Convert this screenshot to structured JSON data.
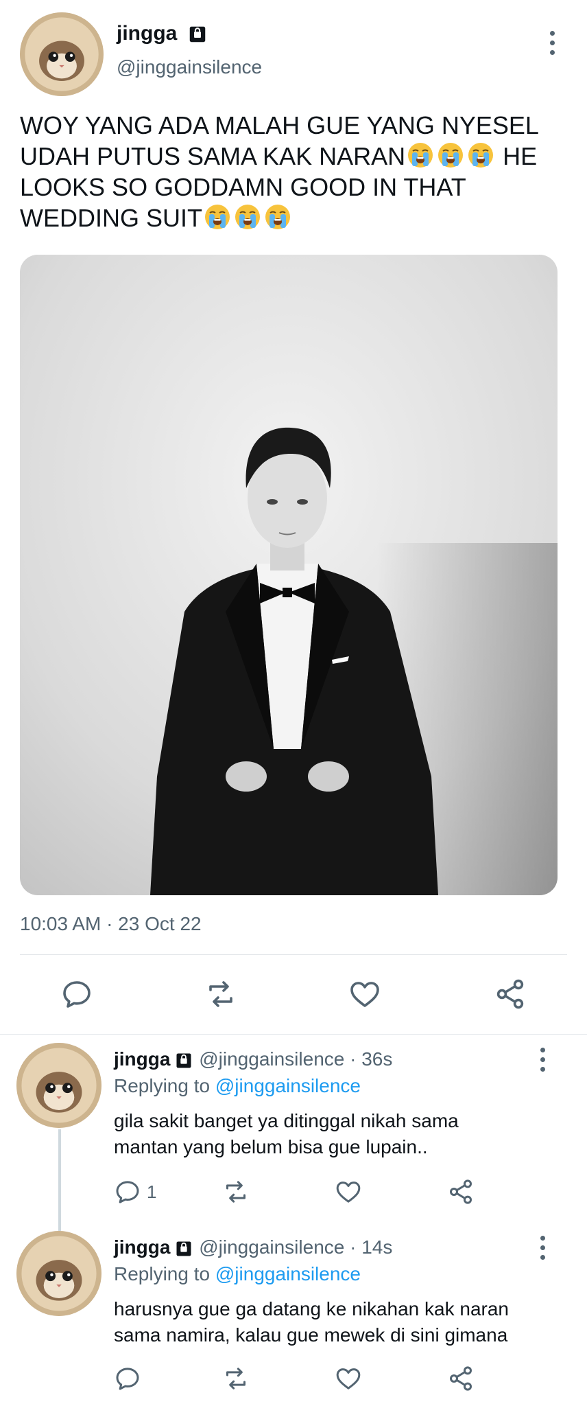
{
  "main_tweet": {
    "display_name": "jingga",
    "handle": "@jinggainsilence",
    "text_line1": "WOY YANG ADA MALAH GUE YANG NYESEL",
    "text_line2a": "UDAH PUTUS SAMA KAK NARAN",
    "text_line2b": "HE",
    "text_line3": "LOOKS SO GODDAMN GOOD IN THAT",
    "text_line4": "WEDDING SUIT",
    "timestamp": "10:03 AM · 23 Oct 22"
  },
  "replies": [
    {
      "display_name": "jingga",
      "handle_time": "@jinggainsilence · 36s",
      "replying_label": "Replying to",
      "replying_handle": "@jinggainsilence",
      "text_line1": "gila sakit banget ya ditinggal nikah sama",
      "text_line2": "mantan yang belum bisa gue lupain..",
      "reply_count": "1"
    },
    {
      "display_name": "jingga",
      "handle_time": "@jinggainsilence · 14s",
      "replying_label": "Replying to",
      "replying_handle": "@jinggainsilence",
      "text_line1": "harusnya gue ga datang ke nikahan kak naran",
      "text_line2": "sama namira, kalau gue mewek di sini gimana",
      "reply_count": ""
    }
  ],
  "icons": [
    "lock-icon",
    "more-icon",
    "reply-icon",
    "retweet-icon",
    "like-icon",
    "share-icon",
    "crying-emoji"
  ],
  "colors": {
    "text": "#0f1419",
    "muted": "#536471",
    "link": "#1d9bf0",
    "divider": "#e3e7ea"
  }
}
